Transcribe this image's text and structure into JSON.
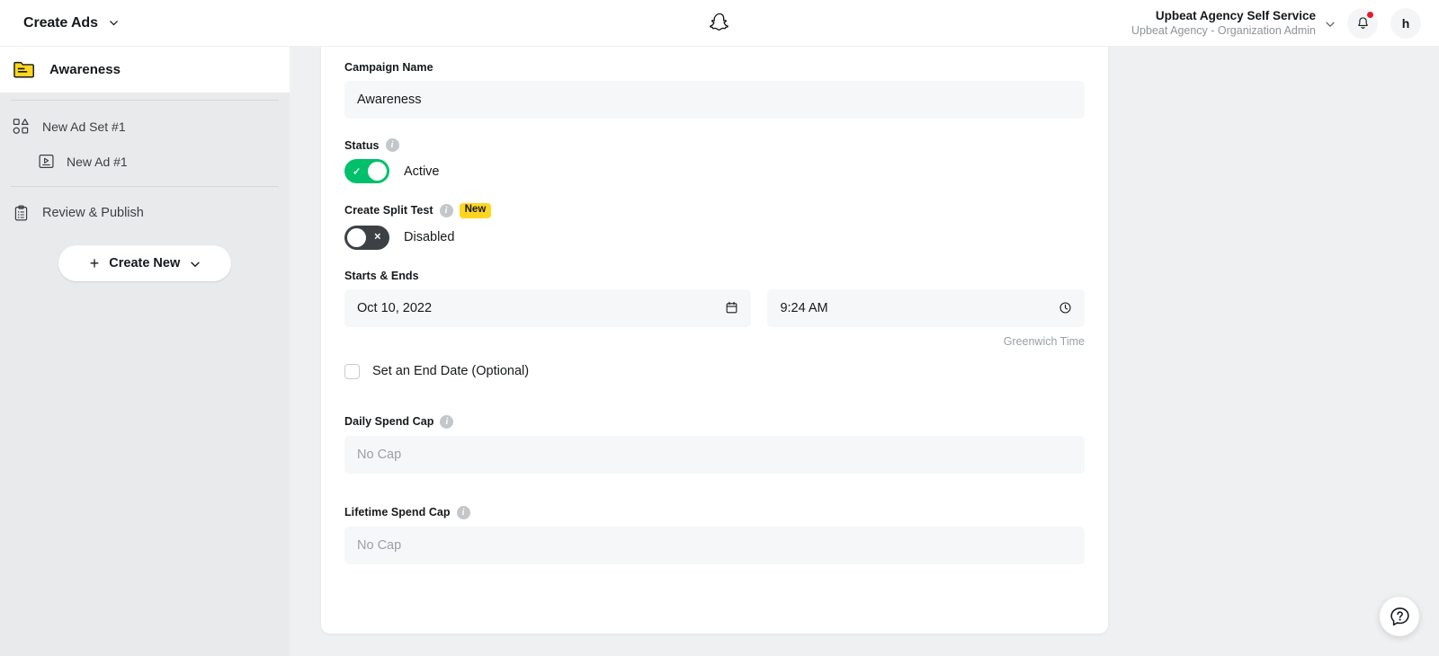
{
  "header": {
    "title": "Create Ads",
    "logo": "snapchat-ghost-logo",
    "account_name": "Upbeat Agency Self Service",
    "account_sub": "Upbeat Agency - Organization Admin",
    "avatar_initial": "h",
    "notification_has_badge": true
  },
  "sidebar": {
    "active_item": {
      "label": "Awareness",
      "icon": "folder-icon"
    },
    "items": [
      {
        "label": "New Ad Set #1",
        "icon": "ad-set-icon",
        "level": 0
      },
      {
        "label": "New Ad #1",
        "icon": "ad-icon",
        "level": 1
      }
    ],
    "review": {
      "label": "Review & Publish",
      "icon": "clipboard-icon"
    },
    "create_new": {
      "label": "Create New",
      "icon": "plus-icon"
    }
  },
  "form": {
    "campaign_name": {
      "label": "Campaign Name",
      "value": "Awareness"
    },
    "status": {
      "label": "Status",
      "toggle_state": "on",
      "toggle_label": "Active"
    },
    "split_test": {
      "label": "Create Split Test",
      "badge": "New",
      "toggle_state": "off",
      "toggle_label": "Disabled"
    },
    "starts_ends": {
      "label": "Starts & Ends",
      "date_value": "Oct 10, 2022",
      "date_icon": "calendar-icon",
      "time_value": "9:24 AM",
      "time_icon": "clock-icon",
      "timezone_note": "Greenwich Time",
      "end_date_checkbox_label": "Set an End Date (Optional)",
      "end_date_checked": false
    },
    "daily_spend_cap": {
      "label": "Daily Spend Cap",
      "placeholder": "No Cap",
      "value": ""
    },
    "lifetime_spend_cap": {
      "label": "Lifetime Spend Cap",
      "placeholder": "No Cap",
      "value": ""
    }
  },
  "help": {
    "icon": "help-chat-icon"
  },
  "colors": {
    "accent_green": "#00c06b",
    "badge_yellow": "#ffd520",
    "notification_red": "#e8192c",
    "folder_yellow": "#ffd520",
    "sidebar_bg": "#e9eaec",
    "main_bg": "#eef0f1",
    "input_bg": "#f6f7f8"
  }
}
